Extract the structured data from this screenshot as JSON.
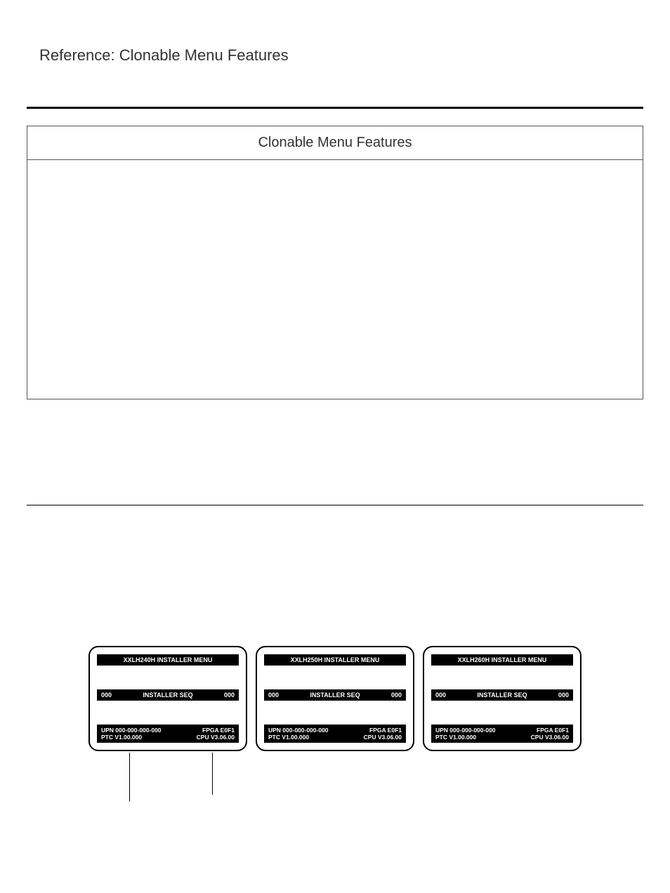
{
  "header": "Reference: Clonable Menu Features",
  "panel_title": "Clonable Menu Features",
  "menus": [
    {
      "title": "XXLH240H INSTALLER  MENU",
      "seq_left": "000",
      "seq_label": "INSTALLER SEQ",
      "seq_right": "000",
      "upn": "UPN   000-000-000-000",
      "ptc": "PTC V1.00.000",
      "fpga": "FPGA E0F1",
      "cpu": "CPU V3.06.00"
    },
    {
      "title": "XXLH250H INSTALLER  MENU",
      "seq_left": "000",
      "seq_label": "INSTALLER SEQ",
      "seq_right": "000",
      "upn": "UPN   000-000-000-000",
      "ptc": "PTC V1.00.000",
      "fpga": "FPGA E0F1",
      "cpu": "CPU V3.06.00"
    },
    {
      "title": "XXLH260H INSTALLER  MENU",
      "seq_left": "000",
      "seq_label": "INSTALLER SEQ",
      "seq_right": "000",
      "upn": "UPN   000-000-000-000",
      "ptc": "PTC V1.00.000",
      "fpga": "FPGA E0F1",
      "cpu": "CPU V3.06.00"
    }
  ]
}
